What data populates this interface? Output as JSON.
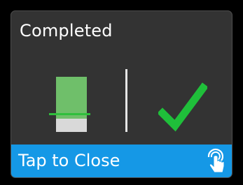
{
  "dialog": {
    "title": "Completed",
    "gauge": {
      "fill_fraction": 0.76
    },
    "status_icon": "checkmark-icon",
    "footer": {
      "label": "Tap to Close",
      "icon": "touch-hand-icon"
    }
  },
  "colors": {
    "background": "#000000",
    "dialog_bg": "#333333",
    "gauge_fill": "#6fbf6a",
    "gauge_empty": "#d9d9d9",
    "gauge_marker": "#2fbf3c",
    "check": "#1fbf3a",
    "footer_bg": "#1598e6",
    "text": "#ffffff"
  }
}
